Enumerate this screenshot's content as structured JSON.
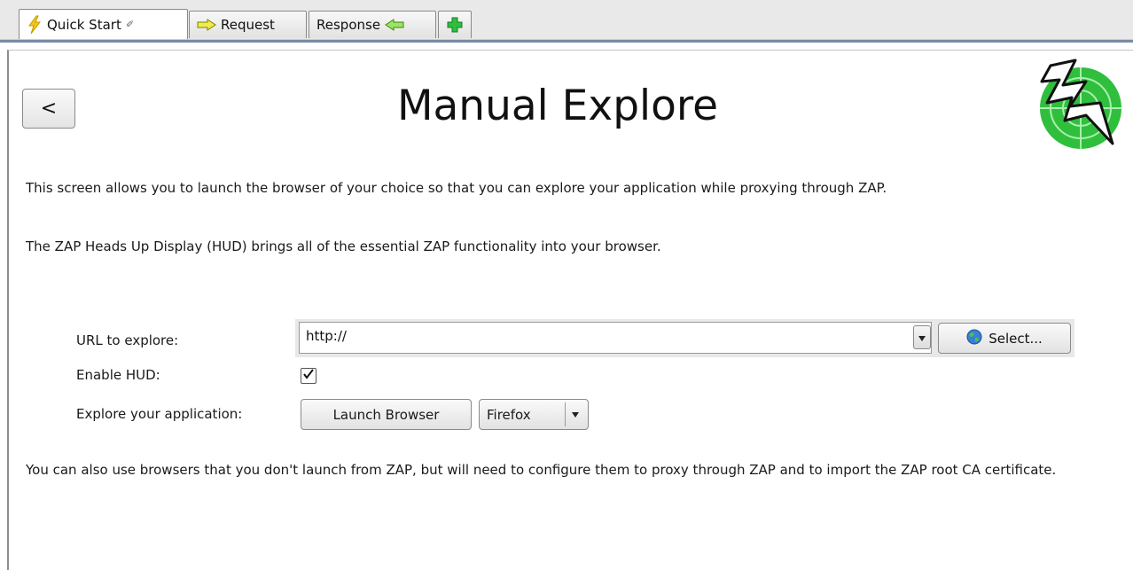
{
  "tabs": [
    {
      "label": "Quick Start",
      "icon": "lightning-icon",
      "active": true,
      "pinned": true
    },
    {
      "label": "Request",
      "icon": "arrow-right-icon",
      "active": false
    },
    {
      "label": "Response",
      "icon": "arrow-left-icon",
      "active": false
    },
    {
      "label": "",
      "icon": "plus-icon",
      "active": false
    }
  ],
  "header": {
    "back_label": "<",
    "title": "Manual Explore",
    "logo_icon": "zap-logo-icon"
  },
  "intro": {
    "p1": "This screen allows you to launch the browser of your choice so that you can explore your application while proxying through ZAP.",
    "p2": "The ZAP Heads Up Display (HUD) brings all of the essential ZAP functionality into your browser."
  },
  "form": {
    "url_label": "URL to explore:",
    "url_value": "http://",
    "select_label": "Select...",
    "hud_label": "Enable HUD:",
    "hud_checked": true,
    "explore_label": "Explore your application:",
    "launch_label": "Launch Browser",
    "browser_value": "Firefox"
  },
  "footer": {
    "p3": "You can also use browsers that you don't launch from ZAP, but will need to configure them to proxy through ZAP and to import the ZAP root CA certificate."
  },
  "colors": {
    "accent_green": "#2fbf3c",
    "lightning_yellow": "#f5c518",
    "tab_line": "#7a8aa6"
  }
}
